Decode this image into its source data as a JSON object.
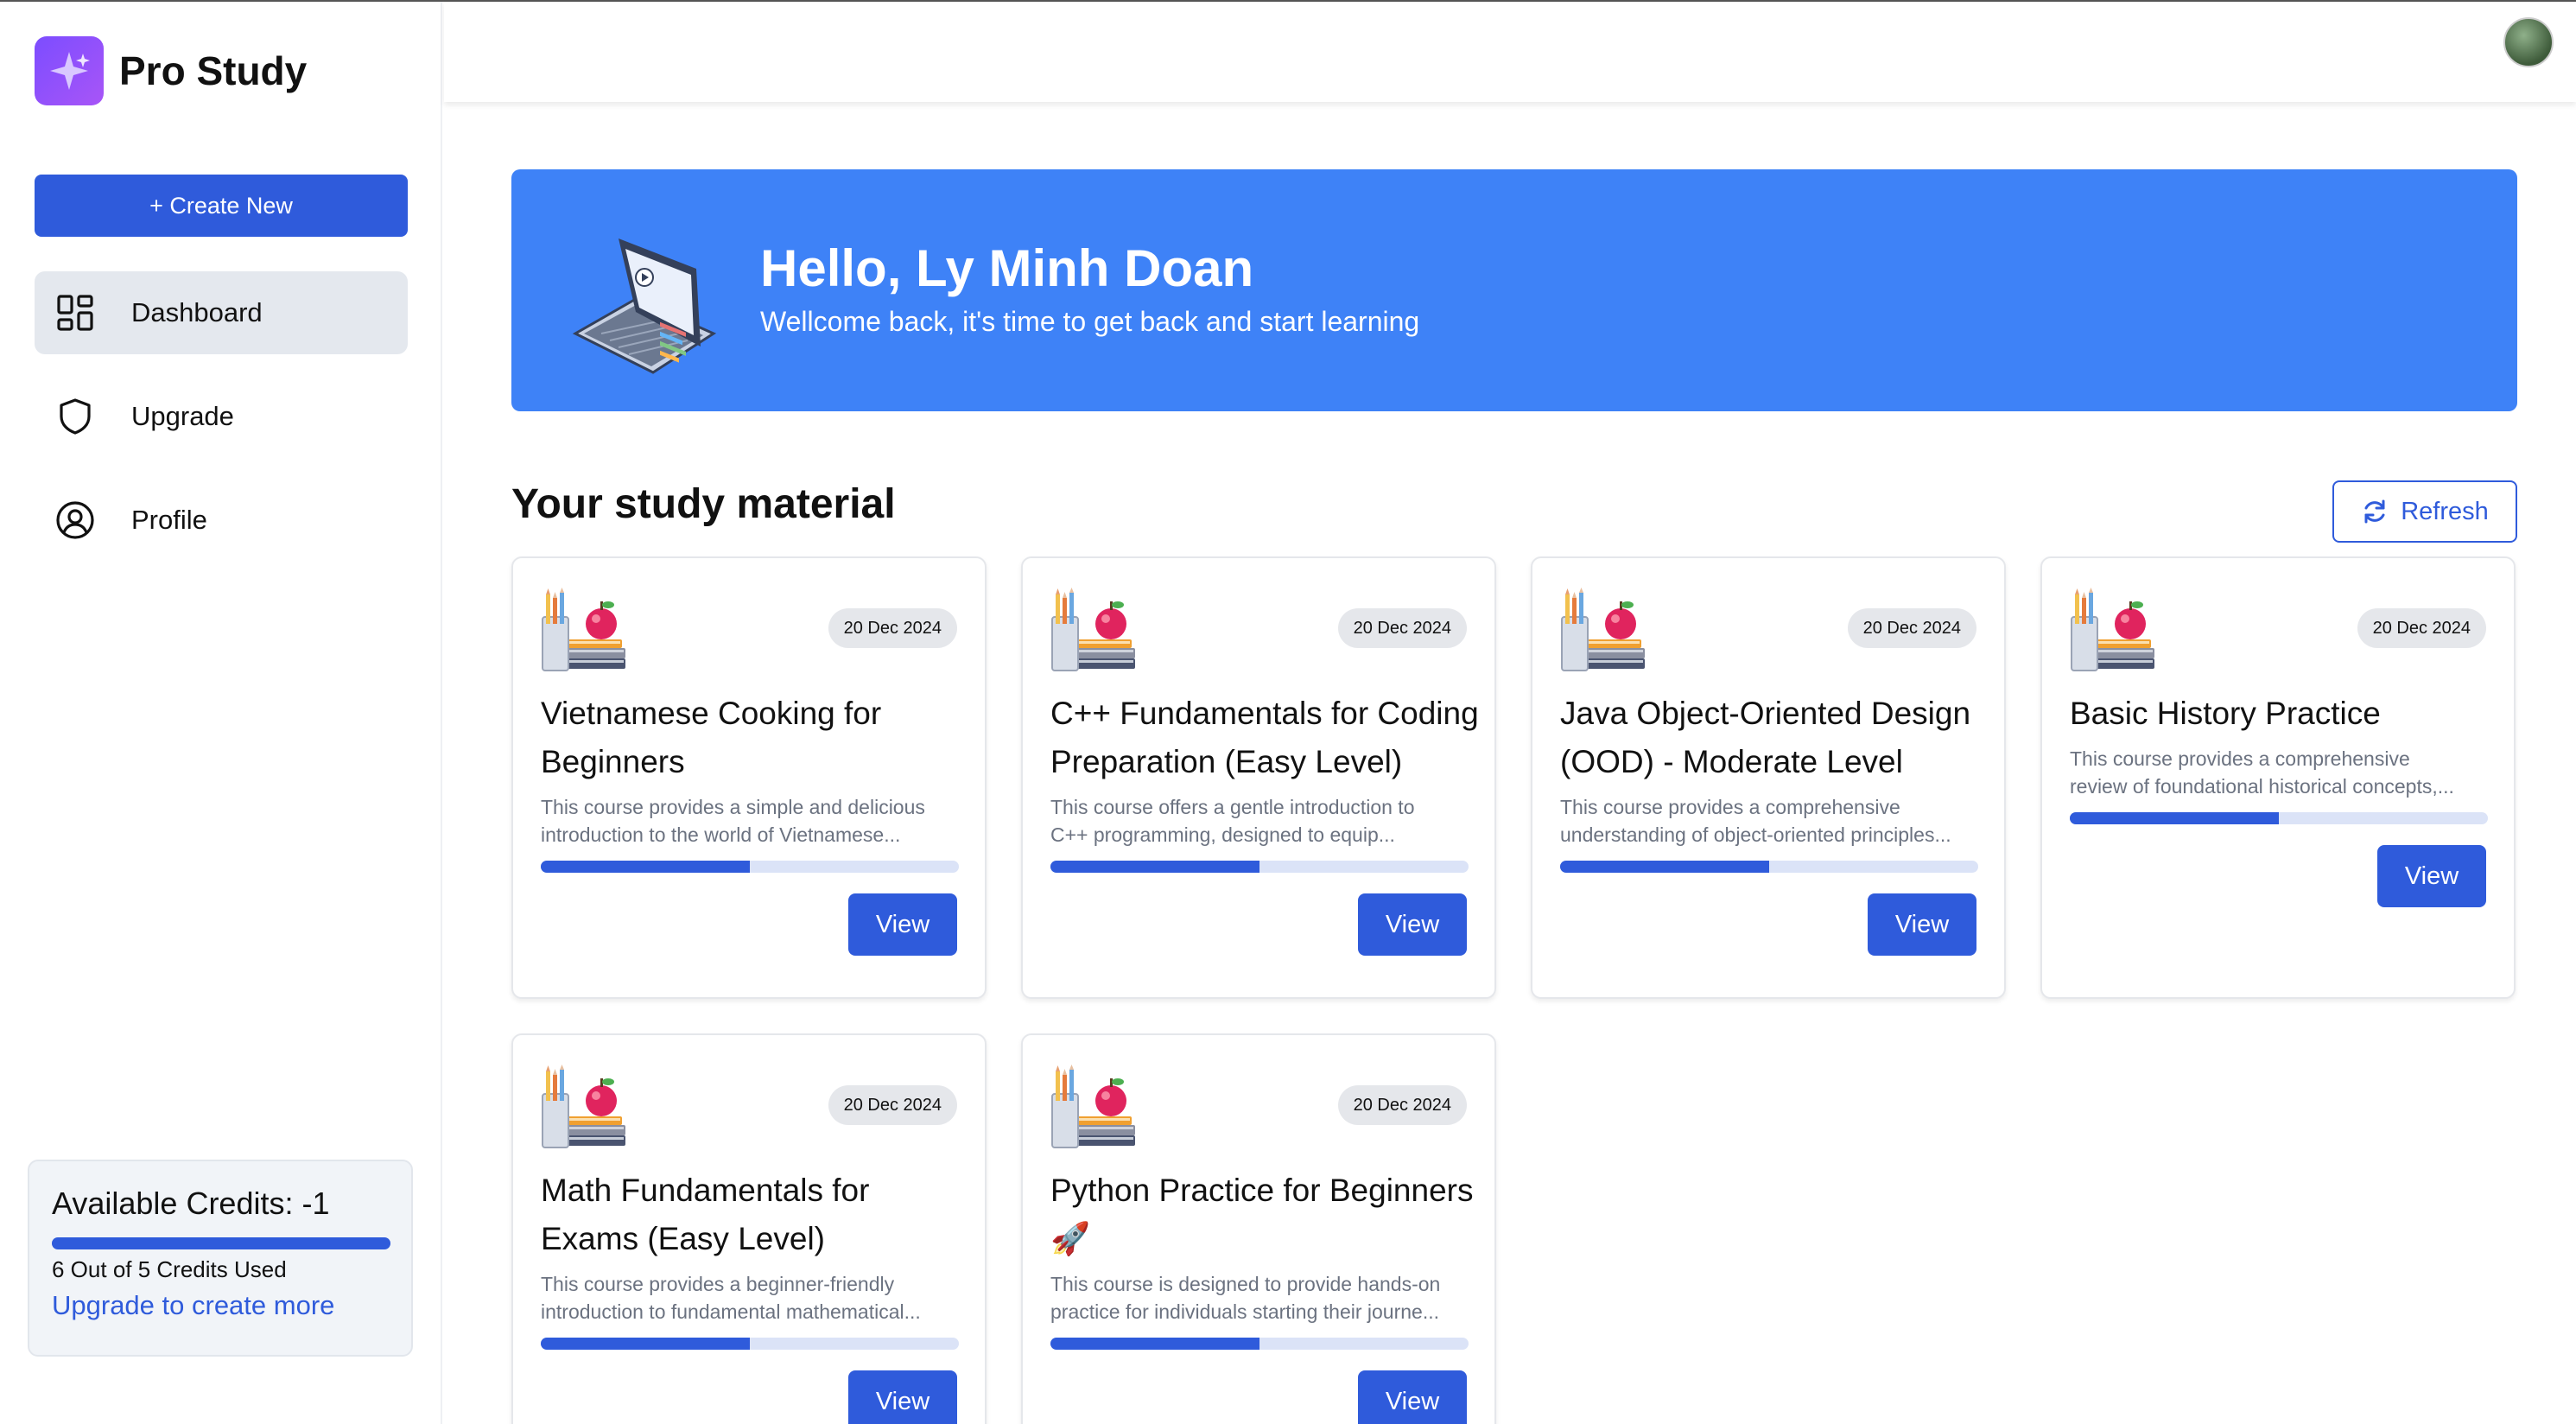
{
  "app": {
    "name": "Pro Study"
  },
  "sidebar": {
    "create_label": "+ Create New",
    "items": [
      {
        "label": "Dashboard",
        "icon": "dashboard-grid-icon",
        "active": true
      },
      {
        "label": "Upgrade",
        "icon": "shield-icon",
        "active": false
      },
      {
        "label": "Profile",
        "icon": "user-circle-icon",
        "active": false
      }
    ],
    "credits": {
      "title": "Available Credits: -1",
      "used_text": "6 Out of 5 Credits Used",
      "upgrade_link": "Upgrade to create more",
      "progress": 1.0
    }
  },
  "banner": {
    "title": "Hello, Ly Minh Doan",
    "subtitle": "Wellcome back, it's time to get back and start learning"
  },
  "section": {
    "title": "Your study material",
    "refresh_label": "Refresh"
  },
  "cards": [
    {
      "date": "20 Dec 2024",
      "title": "Vietnamese Cooking for Beginners",
      "desc_line1": "This course provides a simple and delicious",
      "desc_line2": "introduction to the world of Vietnamese...",
      "progress": 0.5,
      "view_label": "View"
    },
    {
      "date": "20 Dec 2024",
      "title": "C++ Fundamentals for Coding Preparation (Easy Level)",
      "desc_line1": "This course offers a gentle introduction to",
      "desc_line2": "C++ programming, designed to equip...",
      "progress": 0.5,
      "view_label": "View"
    },
    {
      "date": "20 Dec 2024",
      "title": "Java Object-Oriented Design (OOD) - Moderate Level",
      "desc_line1": "This course provides a comprehensive",
      "desc_line2": "understanding of object-oriented principles...",
      "progress": 0.5,
      "view_label": "View"
    },
    {
      "date": "20 Dec 2024",
      "title": "Basic History Practice",
      "desc_line1": "This course provides a comprehensive",
      "desc_line2": "review of foundational historical concepts,...",
      "progress": 0.5,
      "view_label": "View"
    },
    {
      "date": "20 Dec 2024",
      "title": "Math Fundamentals for Exams (Easy Level)",
      "desc_line1": "This course provides a beginner-friendly",
      "desc_line2": "introduction to fundamental mathematical...",
      "progress": 0.5,
      "view_label": "View"
    },
    {
      "date": "20 Dec 2024",
      "title": "Python Practice for Beginners 🚀",
      "desc_line1": "This course is designed to provide hands-on",
      "desc_line2": "practice for individuals starting their journe...",
      "progress": 0.5,
      "view_label": "View"
    }
  ],
  "colors": {
    "accent": "#2f5bdb",
    "banner": "#3e82f7",
    "logo": "#7c4dff"
  }
}
